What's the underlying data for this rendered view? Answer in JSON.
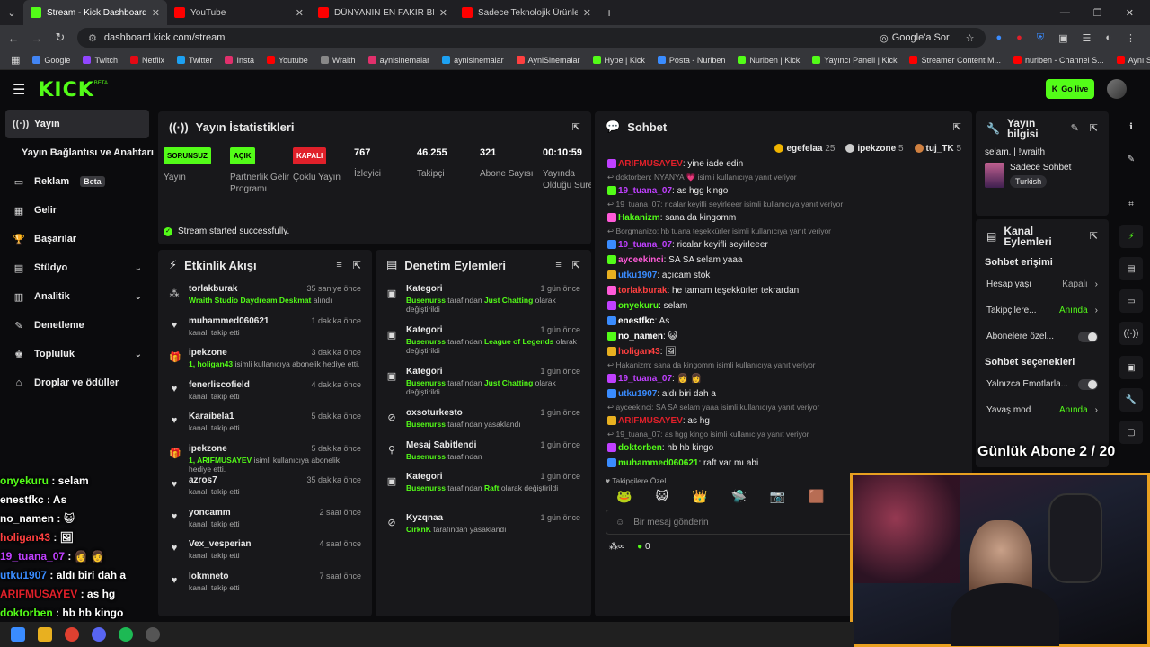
{
  "browser": {
    "tabs": [
      {
        "title": "Stream - Kick Dashboard",
        "color": "#53fc18",
        "active": true
      },
      {
        "title": "YouTube",
        "color": "#ff0000",
        "active": false
      },
      {
        "title": "DÜNYANIN EN FAKİR BİT PAZAR...",
        "color": "#ff0000",
        "active": false
      },
      {
        "title": "Sadece Teknolojik Ürünleri Topl...",
        "color": "#ff0000",
        "active": false
      }
    ],
    "new_tab": "+",
    "url": "dashboard.kick.com/stream",
    "lens_label": "Google'a Sor",
    "bookmarks": [
      "Google",
      "Twitch",
      "Netflix",
      "Twitter",
      "Insta",
      "Youtube",
      "Wraith",
      "aynisinemalar",
      "aynisinemalar",
      "AyniSinemalar",
      "Hype | Kick",
      "Posta - Nuriben",
      "Nuriben | Kick",
      "Yayıncı Paneli | Kick",
      "Streamer Content M...",
      "nuriben - Channel S...",
      "Aynı Sinemalar - Ça..."
    ]
  },
  "header": {
    "logo": "KICK",
    "beta": "BETA",
    "go_live": "Go live"
  },
  "sidebar": {
    "items": [
      {
        "label": "Yayın",
        "icon": "((·))",
        "active": true
      },
      {
        "label": "Yayın Bağlantısı ve Anahtarı",
        "icon": "",
        "active": false
      },
      {
        "label": "Reklam",
        "icon": "▭",
        "beta": "Beta"
      },
      {
        "label": "Gelir",
        "icon": "▦"
      },
      {
        "label": "Başarılar",
        "icon": "🏆"
      },
      {
        "label": "Stüdyo",
        "icon": "▤",
        "chev": "⌄"
      },
      {
        "label": "Analitik",
        "icon": "▥",
        "chev": "⌄"
      },
      {
        "label": "Denetleme",
        "icon": "✎"
      },
      {
        "label": "Topluluk",
        "icon": "♚",
        "chev": "⌄"
      },
      {
        "label": "Droplar ve ödüller",
        "icon": "⌂"
      }
    ]
  },
  "stats": {
    "title": "Yayın İstatistikleri",
    "items": [
      {
        "badge": "SORUNSUZ",
        "badge_color": "#53fc18",
        "label": "Yayın"
      },
      {
        "badge": "AÇIK",
        "badge_color": "#53fc18",
        "label": "Partnerlik Gelir Programı"
      },
      {
        "badge": "KAPALI",
        "badge_color": "#e0202a",
        "label": "Çoklu Yayın"
      },
      {
        "value": "767",
        "label": "İzleyici"
      },
      {
        "value": "46.255",
        "label": "Takipçi"
      },
      {
        "value": "321",
        "label": "Abone Sayısı"
      },
      {
        "value": "00:10:59",
        "label": "Yayında Olduğu Süre"
      }
    ],
    "success": "Stream started successfully."
  },
  "activity": {
    "title": "Etkinlik Akışı",
    "items": [
      {
        "user": "torlakburak",
        "time": "35 saniye önce",
        "sub_green": "Wraith Studio Daydream Deskmat",
        "sub": " alındı",
        "icon": "⁂"
      },
      {
        "user": "muhammed060621",
        "time": "1 dakika önce",
        "sub": "kanalı takip etti",
        "icon": "♥"
      },
      {
        "user": "ipekzone",
        "time": "3 dakika önce",
        "sub_green": "1, holigan43",
        "sub": " isimli kullanıcıya abonelik hediye etti.",
        "icon": "🎁"
      },
      {
        "user": "fenerliscofield",
        "time": "4 dakika önce",
        "sub": "kanalı takip etti",
        "icon": "♥"
      },
      {
        "user": "Karaibela1",
        "time": "5 dakika önce",
        "sub": "kanalı takip etti",
        "icon": "♥"
      },
      {
        "user": "ipekzone",
        "time": "5 dakika önce",
        "sub_green": "1, ARIFMUSAYEV",
        "sub": " isimli kullanıcıya abonelik hediye etti.",
        "icon": "🎁"
      },
      {
        "user": "azros7",
        "time": "35 dakika önce",
        "sub": "kanalı takip etti",
        "icon": "♥"
      },
      {
        "user": "yoncamm",
        "time": "2 saat önce",
        "sub": "kanalı takip etti",
        "icon": "♥"
      },
      {
        "user": "Vex_vesperian",
        "time": "4 saat önce",
        "sub": "kanalı takip etti",
        "icon": "♥"
      },
      {
        "user": "lokmneto",
        "time": "7 saat önce",
        "sub": "kanalı takip etti",
        "icon": "♥"
      }
    ]
  },
  "moderation": {
    "title": "Denetim Eylemleri",
    "items": [
      {
        "title": "Kategori",
        "time": "1 gün önce",
        "actor": "Busenurss",
        "mid": " tarafından ",
        "target": "Just Chatting",
        "tail": " olarak değiştirildi",
        "icon": "▣"
      },
      {
        "title": "Kategori",
        "time": "1 gün önce",
        "actor": "Busenurss",
        "mid": " tarafından ",
        "target": "League of Legends",
        "tail": " olarak değiştirildi",
        "icon": "▣"
      },
      {
        "title": "Kategori",
        "time": "1 gün önce",
        "actor": "Busenurss",
        "mid": " tarafından ",
        "target": "Just Chatting",
        "tail": " olarak değiştirildi",
        "icon": "▣"
      },
      {
        "title": "oxsoturkesto",
        "time": "1 gün önce",
        "actor": "Busenurss",
        "mid": " tarafından yasaklandı",
        "target": "",
        "tail": "",
        "icon": "⊘"
      },
      {
        "title": "Mesaj Sabitlendi",
        "time": "1 gün önce",
        "actor": "Busenurss",
        "mid": " tarafından",
        "target": "",
        "tail": "",
        "icon": "⚲"
      },
      {
        "title": "Kategori",
        "time": "1 gün önce",
        "actor": "Busenurss",
        "mid": " tarafından ",
        "target": "Raft",
        "tail": "  olarak değiştirildi",
        "icon": "▣"
      },
      {
        "title": "Kyzqnaa",
        "time": "1 gün önce",
        "actor": "CirknK",
        "mid": " tarafından yasaklandı",
        "target": "",
        "tail": "",
        "icon": "⊘"
      }
    ]
  },
  "chat": {
    "title": "Sohbet",
    "top": [
      {
        "name": "egefelaa",
        "count": "25",
        "color": "#f0b400"
      },
      {
        "name": "ipekzone",
        "count": "5",
        "color": "#cccccc"
      },
      {
        "name": "tuj_TK",
        "count": "5",
        "color": "#d08040"
      }
    ],
    "lines": [
      {
        "type": "msg",
        "user": "ARIFMUSAYEV",
        "color": "#e0202a",
        "text": ": yine iade edin"
      },
      {
        "type": "reply",
        "text": "doktorben: NYANYA 💗 isimli kullanıcıya yanıt veriyor"
      },
      {
        "type": "msg",
        "user": "19_tuana_07",
        "color": "#c040ff",
        "text": ": as hgg kingo"
      },
      {
        "type": "reply",
        "text": "19_tuana_07: ricalar keyifli seyirleeer isimli kullanıcıya yanıt veriyor"
      },
      {
        "type": "msg",
        "user": "Hakanizm",
        "color": "#53fc18",
        "text": ": sana da kingomm"
      },
      {
        "type": "reply",
        "text": "Borgmanizo: hb tuana teşekkürler isimli kullanıcıya yanıt veriyor"
      },
      {
        "type": "msg",
        "user": "19_tuana_07",
        "color": "#c040ff",
        "text": ": ricalar keyifli seyirleeer"
      },
      {
        "type": "msg",
        "user": "ayceekinci",
        "color": "#ff5ad8",
        "text": ": SA SA  selam yaaa"
      },
      {
        "type": "msg",
        "user": "utku1907",
        "color": "#3a8cff",
        "text": ": açıcam stok"
      },
      {
        "type": "msg",
        "user": "torlakburak",
        "color": "#ff4040",
        "text": ": he tamam teşekkürler tekrardan"
      },
      {
        "type": "msg",
        "user": "onyekuru",
        "color": "#53fc18",
        "text": ": selam"
      },
      {
        "type": "msg",
        "user": "enestfkc",
        "color": "#ffffff",
        "text": ": As"
      },
      {
        "type": "msg",
        "user": "no_namen",
        "color": "#ffffff",
        "text": ": 😺"
      },
      {
        "type": "msg",
        "user": "holigan43",
        "color": "#ff4040",
        "text": ": 🖼"
      },
      {
        "type": "reply",
        "text": "Hakanizm: sana da kingomm isimli kullanıcıya yanıt veriyor"
      },
      {
        "type": "msg",
        "user": "19_tuana_07",
        "color": "#c040ff",
        "text": ": 👩 👩"
      },
      {
        "type": "msg",
        "user": "utku1907",
        "color": "#3a8cff",
        "text": ": aldı biri dah a"
      },
      {
        "type": "reply",
        "text": "ayceekinci: SA SA selam yaaa isimli kullanıcıya yanıt veriyor"
      },
      {
        "type": "msg",
        "user": "ARIFMUSAYEV",
        "color": "#e0202a",
        "text": ": as hg"
      },
      {
        "type": "reply",
        "text": "19_tuana_07: as hgg kingo isimli kullanıcıya yanıt veriyor"
      },
      {
        "type": "msg",
        "user": "doktorben",
        "color": "#53fc18",
        "text": ": hb hb kingo"
      },
      {
        "type": "msg",
        "user": "muhammed060621",
        "color": "#53fc18",
        "text": ": raft var mı abi"
      }
    ],
    "followers_only": "Takipçilere Özel",
    "placeholder": "Bir mesaj gönderin",
    "points": "0"
  },
  "stream_info": {
    "title": "Yayın bilgisi",
    "stream_title": "selam. | !wraith",
    "category": "Sadece Sohbet",
    "language": "Turkish"
  },
  "channel_actions": {
    "title": "Kanal Eylemleri",
    "chat_access": "Sohbet erişimi",
    "rows1": [
      {
        "label": "Hesap yaşı",
        "value": "Kapalı",
        "value_color": "#aaaaaa"
      },
      {
        "label": "Takipçilere...",
        "value": "Anında",
        "value_color": "#53fc18"
      },
      {
        "label": "Abonelere özel...",
        "toggle": true
      }
    ],
    "chat_options": "Sohbet seçenekleri",
    "rows2": [
      {
        "label": "Yalnızca Emotlarla...",
        "toggle": true
      },
      {
        "label": "Yavaş mod",
        "value": "Anında",
        "value_color": "#53fc18"
      }
    ]
  },
  "overlay": {
    "sub_goal": "Günlük Abone 2 / 20",
    "chat": [
      {
        "user": "onyekuru",
        "text": " : selam",
        "color": "#53fc18"
      },
      {
        "user": "enestfkc",
        "text": " : As",
        "color": "#ffffff"
      },
      {
        "user": "no_namen",
        "text": " : 😺",
        "color": "#ffffff"
      },
      {
        "user": "holigan43",
        "text": " : 🖼",
        "color": "#ff4040"
      },
      {
        "user": "19_tuana_07",
        "text": " : 👩 👩",
        "color": "#c040ff"
      },
      {
        "user": "utku1907",
        "text": " : aldı biri dah a",
        "color": "#3a8cff"
      },
      {
        "user": "ARIFMUSAYEV",
        "text": " : as hg",
        "color": "#e0202a"
      },
      {
        "user": "doktorben",
        "text": " : hb hb kingo",
        "color": "#53fc18"
      }
    ]
  }
}
